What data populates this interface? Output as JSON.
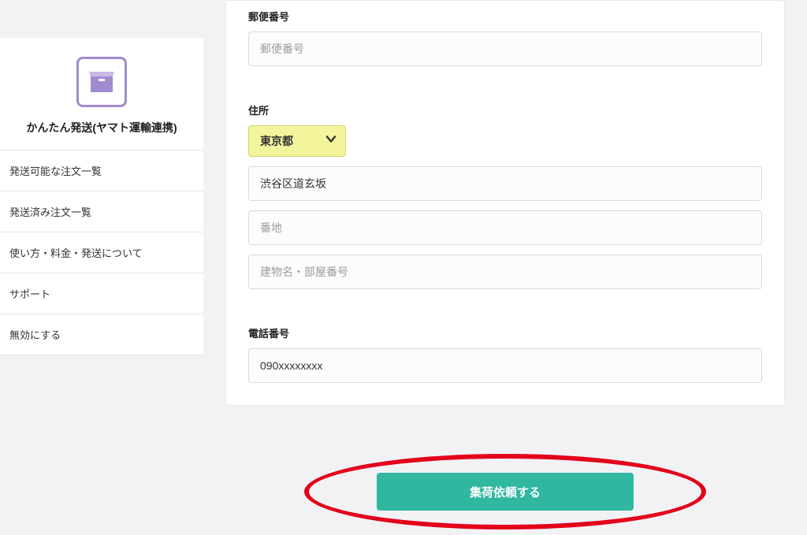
{
  "sidebar": {
    "title": "かんたん発送(ヤマト運輸連携)",
    "items": [
      {
        "label": "発送可能な注文一覧"
      },
      {
        "label": "発送済み注文一覧"
      },
      {
        "label": "使い方・料金・発送について"
      },
      {
        "label": "サポート"
      },
      {
        "label": "無効にする"
      }
    ]
  },
  "form": {
    "postal": {
      "label": "郵便番号",
      "placeholder": "郵便番号",
      "value": ""
    },
    "address": {
      "label": "住所",
      "prefecture": "東京都",
      "city_value": "渋谷区道玄坂",
      "street_placeholder": "番地",
      "street_value": "",
      "building_placeholder": "建物名・部屋番号",
      "building_value": ""
    },
    "phone": {
      "label": "電話番号",
      "value": "090xxxxxxxx"
    }
  },
  "submit": {
    "label": "集荷依頼する"
  }
}
